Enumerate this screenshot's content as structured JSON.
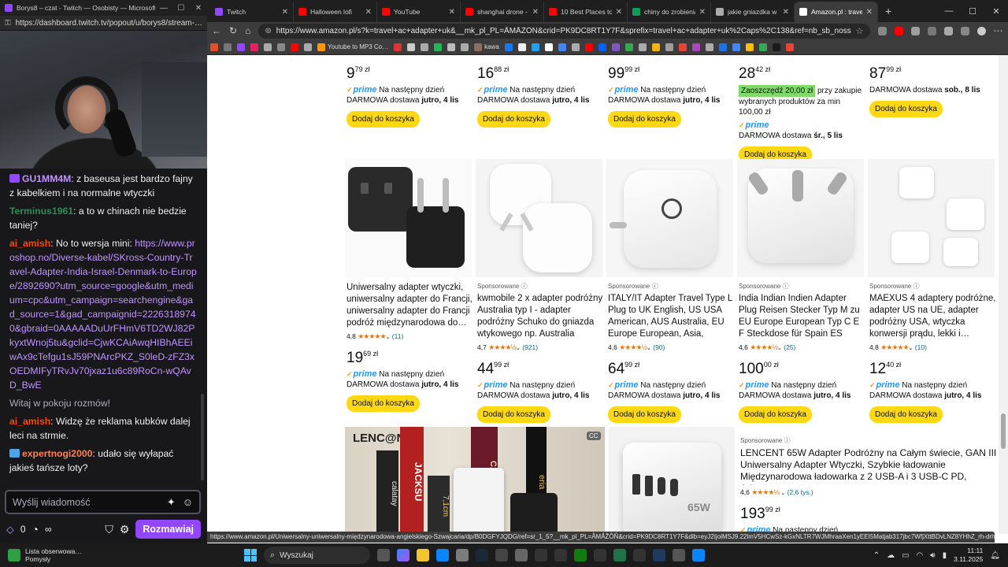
{
  "twitch": {
    "window_title": "Borys8 – czat - Twitch — Osobisty — Microsoft…",
    "url": "https://dashboard.twitch.tv/popout/u/borys8/stream-…",
    "messages": [
      {
        "user": "GU1MM4M",
        "color": "#bf94ff",
        "text": ": z baseusa jest bardzo fajny z kabelkiem i na normalne wtyczki",
        "badge": "#9146ff"
      },
      {
        "user": "Terminus1961",
        "color": "#2e8b57",
        "text": ": a to w chinach nie bedzie taniej?"
      },
      {
        "user": "ai_amish",
        "color": "#ff4500",
        "text": ": No to wersja mini: ",
        "link": "https://www.proshop.no/Diverse-kabel/SKross-Country-Travel-Adapter-India-Israel-Denmark-to-Europe/2892690?utm_source=google&utm_medium=cpc&utm_campaign=searchengine&gad_source=1&gad_campaignid=22263189740&gbraid=0AAAAADuUrFHmV6TD2WJ82PkyxtWnoj5tu&gclid=CjwKCAiAwqHIBhAEEiwAx9cTefgu1sJ59PNArcPKZ_S0leD-zFZ3xOEDMIFyTRvJv70jxaz1u6c89RoCn-wQAvD_BwE"
      },
      {
        "system": "Witaj w pokoju rozmów!"
      },
      {
        "user": "ai_amish",
        "color": "#ff4500",
        "text": ": Widzę że reklama kubków dalej leci na strmie."
      },
      {
        "user": "expertnogi2000",
        "color": "#ff7f50",
        "text": ": udało się wyłapać jakieś tańsze loty?",
        "badge": "#4fa3e8"
      }
    ],
    "input_placeholder": "Wyślij wiadomość",
    "points": "0",
    "infinity": "∞",
    "chat_button": "Rozmawiaj"
  },
  "browser": {
    "tabs": [
      {
        "label": "Twitch",
        "fav": "#9146ff",
        "active": false
      },
      {
        "label": "Halloween lofi",
        "fav": "#ff0000",
        "active": false
      },
      {
        "label": "YouTube",
        "fav": "#ff0000",
        "active": false
      },
      {
        "label": "shanghai drone - You",
        "fav": "#ff0000",
        "active": false
      },
      {
        "label": "10 Best Places to Visi",
        "fav": "#ff0000",
        "active": false
      },
      {
        "label": "chiny do zrobienia - G",
        "fav": "#0f9d58",
        "active": false
      },
      {
        "label": "jakie gniazdka w chin",
        "fav": "#aaaaaa",
        "active": false
      },
      {
        "label": "Amazon.pl : travel a",
        "fav": "#ffffff",
        "active": true
      }
    ],
    "url": "https://www.amazon.pl/s?k=travel+ac+adapter+uk&__mk_pl_PL=ÅMÅŽÕÑ&crid=PK9DC8RT1Y7F&sprefix=travel+ac+adapter+uk%2Caps%2C138&ref=nb_sb_noss",
    "bookmarks": [
      {
        "label": "",
        "color": "#e44d26"
      },
      {
        "label": "",
        "color": "#777"
      },
      {
        "label": "",
        "color": "#9146ff"
      },
      {
        "label": "",
        "color": "#e91e63"
      },
      {
        "label": "",
        "color": "#aaa"
      },
      {
        "label": "",
        "color": "#888"
      },
      {
        "label": "",
        "color": "#ff0000"
      },
      {
        "label": "",
        "color": "#aaa"
      },
      {
        "label": "Youtube to MP3 Co…",
        "color": "#ff9800"
      },
      {
        "label": "",
        "color": "#d33"
      },
      {
        "label": "",
        "color": "#ccc"
      },
      {
        "label": "",
        "color": "#aaa"
      },
      {
        "label": "",
        "color": "#1db954"
      },
      {
        "label": "",
        "color": "#bbb"
      },
      {
        "label": "",
        "color": "#aaa"
      },
      {
        "label": "kawa",
        "color": "#8d6e63"
      },
      {
        "label": "",
        "color": "#1877f2"
      },
      {
        "label": "",
        "color": "#eee"
      },
      {
        "label": "",
        "color": "#1da1f2"
      },
      {
        "label": "",
        "color": "#ffffff"
      },
      {
        "label": "",
        "color": "#4285f4"
      },
      {
        "label": "",
        "color": "#aaa"
      },
      {
        "label": "",
        "color": "#ff0000"
      },
      {
        "label": "",
        "color": "#0061fe"
      },
      {
        "label": "",
        "color": "#7e57c2"
      },
      {
        "label": "",
        "color": "#34a853"
      },
      {
        "label": "",
        "color": "#aaa"
      },
      {
        "label": "",
        "color": "#f4b400"
      },
      {
        "label": "",
        "color": "#9e9e9e"
      },
      {
        "label": "",
        "color": "#ea4335"
      },
      {
        "label": "",
        "color": "#ab47bc"
      },
      {
        "label": "",
        "color": "#aaa"
      },
      {
        "label": "",
        "color": "#1a73e8"
      },
      {
        "label": "",
        "color": "#4285f4"
      },
      {
        "label": "",
        "color": "#fbbc05"
      },
      {
        "label": "",
        "color": "#34a853"
      },
      {
        "label": "",
        "color": "#1a1a1a"
      },
      {
        "label": "",
        "color": "#ea4335"
      }
    ],
    "status_url": "https://www.amazon.pl/Uniwersalny-uniwersalny-międzynarodowa-angielskiego-Szwajcaria/dp/B0DGFYJQDG/ref=sr_1_5?__mk_pl_PL=ÅMÅŽÕÑ&crid=PK9DC8RT1Y7F&dib=eyJ2IjoiMSJ9.22lmV5HCwSz-kGxNLTR7WJMhraaXen1yEEI5Matjab317jbc7WfjXttBDvLNZ8YHhZ_rh-drhFWsGZDkl_EWRFge…"
  },
  "top_row": [
    {
      "price_main": "9",
      "price_frac": "79 zł",
      "prime": "prime",
      "prime_text": "Na następny dzień",
      "deliv_pre": "DARMOWA dostawa ",
      "deliv_bold": "jutro, 4 lis",
      "add": "Dodaj do koszyka"
    },
    {
      "price_main": "16",
      "price_frac": "88 zł",
      "prime": "prime",
      "prime_text": "Na następny dzień",
      "deliv_pre": "DARMOWA dostawa ",
      "deliv_bold": "jutro, 4 lis",
      "add": "Dodaj do koszyka"
    },
    {
      "price_main": "99",
      "price_frac": "99 zł",
      "prime": "prime",
      "prime_text": "Na następny dzień",
      "deliv_pre": "DARMOWA dostawa ",
      "deliv_bold": "jutro, 4 lis",
      "add": "Dodaj do koszyka"
    },
    {
      "price_main": "28",
      "price_frac": "42 zł",
      "save": "Zaoszczędź 20,00 zł",
      "save_rest": " przy zakupie wybranych produktów za min 100,00 zł",
      "prime": "prime",
      "deliv_pre": "DARMOWA dostawa ",
      "deliv_bold": "śr., 5 lis",
      "add": "Dodaj do koszyka"
    },
    {
      "price_main": "87",
      "price_frac": "99 zł",
      "deliv_pre": "DARMOWA dostawa ",
      "deliv_bold": "sob., 8 lis",
      "add": "Dodaj do koszyka"
    }
  ],
  "mid_row": [
    {
      "sponsored": "",
      "title": "Uniwersalny adapter wtyczki, uniwersalny adapter do Francji, uniwersalny adapter do Francji podróż międzynarodowa do…",
      "rating": "4,8",
      "stars": "★★★★★",
      "count": "(11)",
      "price_main": "19",
      "price_frac": "69 zł",
      "prime": "prime",
      "prime_text": "Na następny dzień",
      "deliv_pre": "DARMOWA dostawa ",
      "deliv_bold": "jutro, 4 lis",
      "add": "Dodaj do koszyka"
    },
    {
      "sponsored": "Sponsorowane",
      "title": "kwmobile 2 x adapter podróżny Australia typ I - adapter podróżny Schuko do gniazda wtykowego np. Australia Now…",
      "rating": "4,7",
      "stars": "★★★★½",
      "count": "(921)",
      "price_main": "44",
      "price_frac": "99 zł",
      "prime": "prime",
      "prime_text": "Na następny dzień",
      "deliv_pre": "DARMOWA dostawa ",
      "deliv_bold": "jutro, 4 lis",
      "add": "Dodaj do koszyka"
    },
    {
      "sponsored": "Sponsorowane",
      "title": "ITALY/IT Adapter Travel Type L Plug to UK English, US USA American, AUS Australia, EU Europe European, Asia, China,…",
      "rating": "4,6",
      "stars": "★★★★½",
      "count": "(90)",
      "price_main": "64",
      "price_frac": "99 zł",
      "prime": "prime",
      "prime_text": "Na następny dzień",
      "deliv_pre": "DARMOWA dostawa ",
      "deliv_bold": "jutro, 4 lis",
      "add": "Dodaj do koszyka"
    },
    {
      "sponsored": "Sponsorowane",
      "title": "India Indian Indien Adapter Plug Reisen Stecker Typ M zu EU Europe European Typ C E F Steckdose für Spain ES France …",
      "rating": "4,6",
      "stars": "★★★★½",
      "count": "(25)",
      "price_main": "100",
      "price_frac": "00 zł",
      "prime": "prime",
      "prime_text": "Na następny dzień",
      "deliv_pre": "DARMOWA dostawa ",
      "deliv_bold": "jutro, 4 lis",
      "add": "Dodaj do koszyka"
    },
    {
      "sponsored": "Sponsorowane",
      "title": "MAEXUS 4 adaptery podróżne, adapter US na UE, adapter podróżny USA, wtyczka konwersji prądu, lekki i…",
      "rating": "4,8",
      "stars": "★★★★★",
      "count": "(10)",
      "price_main": "12",
      "price_frac": "40 zł",
      "prime": "prime",
      "prime_text": "Na następny dzień",
      "deliv_pre": "DARMOWA dostawa ",
      "deliv_bold": "jutro, 4 lis",
      "add": "Dodaj do koszyka"
    }
  ],
  "bottom_item": {
    "sponsored": "Sponsorowane",
    "title": "LENCENT 65W Adapter Podróżny na Całym świecie, GAN III Uniwersalny Adapter Wtyczki, Szybkie ładowanie Międzynarodowa ładowarka z 2 USB-A i 3 USB-C PD, Adapte…",
    "rating": "4,6",
    "stars": "★★★★½",
    "count": "(2,6 tys.)",
    "price_main": "193",
    "price_frac": "99 zł",
    "prime": "prime",
    "prime_text": "Na następny dzień",
    "img_brand": "LENC@NT",
    "book_texts": [
      "JACKSU",
      "calatay",
      "CARFACE",
      "eria",
      "7,1cm"
    ],
    "cube_label": "65W"
  },
  "taskbar": {
    "weather_line1": "Lista obserwowa…",
    "weather_line2": "Pomysły",
    "search": "Wyszukaj",
    "time": "11:11",
    "date": "3.11.2025"
  }
}
